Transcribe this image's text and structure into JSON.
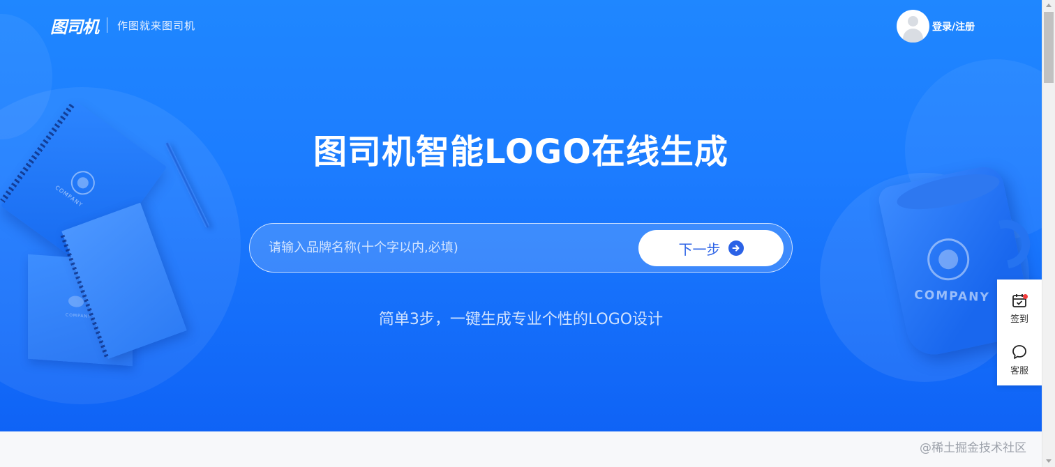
{
  "header": {
    "logo_text": "图司机",
    "slogan": "作图就来图司机",
    "login_label": "登录/注册"
  },
  "hero": {
    "title": "图司机智能LOGO在线生成",
    "search_placeholder": "请输入品牌名称(十个字以内,必填)",
    "next_button_label": "下一步",
    "subtitle": "简单3步，一键生成专业个性的LOGO设计"
  },
  "mockups": {
    "notebook_text": "COMPANY",
    "booklet_text": "COMPANY",
    "mug_text": "COMPANY"
  },
  "side_toolbar": {
    "items": [
      {
        "label": "签到",
        "icon": "calendar-check-icon"
      },
      {
        "label": "客服",
        "icon": "chat-bubble-icon"
      }
    ]
  },
  "watermark": "@稀土掘金技术社区",
  "colors": {
    "hero_gradient_top": "#1f87ff",
    "hero_gradient_bottom": "#0f63f6",
    "accent_text": "#2b62e6",
    "notification_dot": "#f23d3d"
  }
}
